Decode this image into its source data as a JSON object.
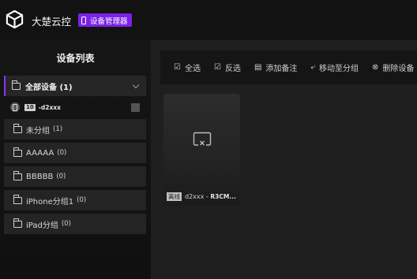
{
  "header": {
    "app_title": "大楚云控",
    "badge_label": "设备管理器"
  },
  "sidebar": {
    "title": "设备列表",
    "all": {
      "label": "全部设备",
      "count": "(1)"
    },
    "device": {
      "version": "10",
      "name": "-d2xxx"
    },
    "groups": [
      {
        "label": "未分组",
        "count": "(1)"
      },
      {
        "label": "AAAAA",
        "count": "(0)"
      },
      {
        "label": "BBBBB",
        "count": "(0)"
      },
      {
        "label": "iPhone分组1",
        "count": "(0)"
      },
      {
        "label": "iPad分组",
        "count": "(0)"
      }
    ]
  },
  "toolbar": {
    "items": [
      {
        "label": "全选",
        "icon": "check-square-icon"
      },
      {
        "label": "反选",
        "icon": "invert-check-icon"
      },
      {
        "label": "添加备注",
        "icon": "note-icon"
      },
      {
        "label": "移动至分组",
        "icon": "move-icon"
      },
      {
        "label": "删除设备",
        "icon": "delete-icon"
      }
    ]
  },
  "card": {
    "status": "离线",
    "name_prefix": "d2xxx - ",
    "name_suffix": "R3CM..."
  }
}
